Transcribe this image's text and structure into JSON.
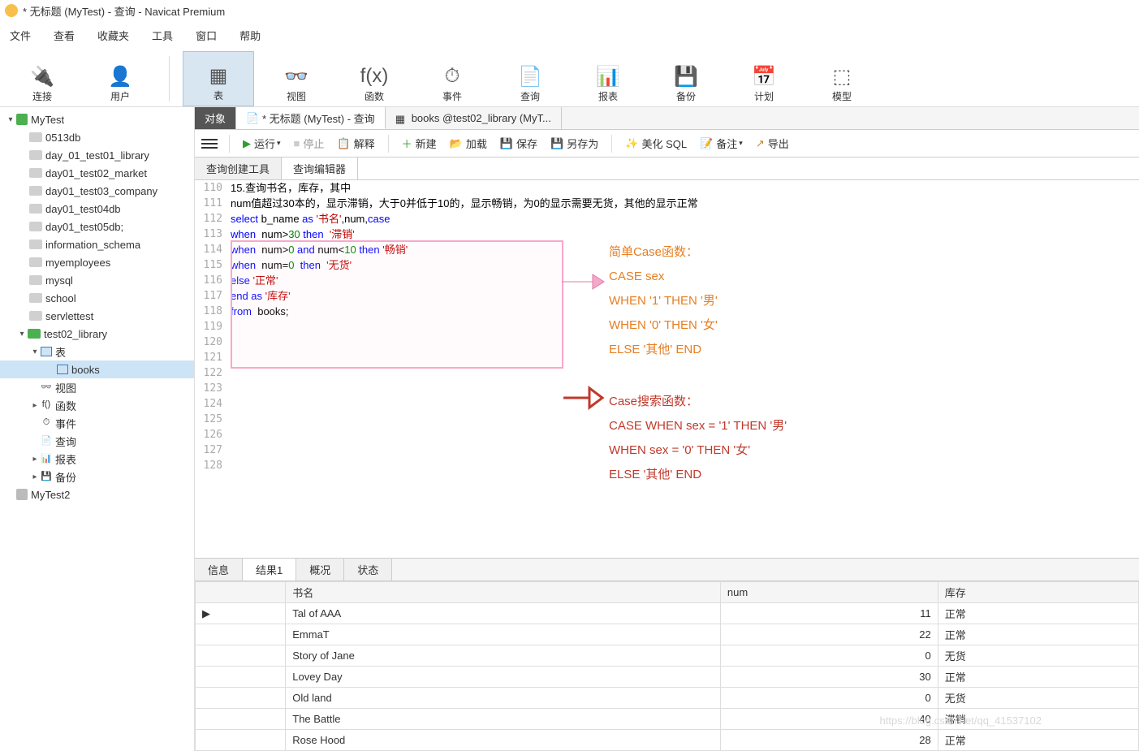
{
  "title": "* 无标题 (MyTest) - 查询 - Navicat Premium",
  "menu": [
    "文件",
    "查看",
    "收藏夹",
    "工具",
    "窗口",
    "帮助"
  ],
  "toolbar": [
    {
      "id": "connect",
      "label": "连接",
      "glyph": "🔌"
    },
    {
      "id": "user",
      "label": "用户",
      "glyph": "👤"
    },
    {
      "id": "table",
      "label": "表",
      "glyph": "▦",
      "sel": true
    },
    {
      "id": "view",
      "label": "视图",
      "glyph": "👓"
    },
    {
      "id": "func",
      "label": "函数",
      "glyph": "f(x)"
    },
    {
      "id": "event",
      "label": "事件",
      "glyph": "⏱"
    },
    {
      "id": "query",
      "label": "查询",
      "glyph": "📄"
    },
    {
      "id": "report",
      "label": "报表",
      "glyph": "📊"
    },
    {
      "id": "backup",
      "label": "备份",
      "glyph": "💾"
    },
    {
      "id": "schedule",
      "label": "计划",
      "glyph": "📅"
    },
    {
      "id": "model",
      "label": "模型",
      "glyph": "⬚"
    }
  ],
  "tree": {
    "server": "MyTest",
    "server2": "MyTest2",
    "dbs": [
      "0513db",
      "day_01_test01_library",
      "day01_test02_market",
      "day01_test03_company",
      "day01_test04db",
      "day01_test05db;",
      "information_schema",
      "myemployees",
      "mysql",
      "school",
      "servlettest"
    ],
    "openDb": "test02_library",
    "tablesLabel": "表",
    "tables": [
      "books"
    ],
    "objs": [
      {
        "label": "视图",
        "glyph": "👓"
      },
      {
        "label": "函数",
        "glyph": "f()"
      },
      {
        "label": "事件",
        "glyph": "⏱"
      },
      {
        "label": "查询",
        "glyph": "📄"
      },
      {
        "label": "报表",
        "glyph": "📊"
      },
      {
        "label": "备份",
        "glyph": "💾"
      }
    ]
  },
  "docTabs": {
    "obj": "对象",
    "qry": "* 无标题 (MyTest) - 查询",
    "tbl": "books @test02_library (MyT..."
  },
  "actions": {
    "run": "运行",
    "stop": "停止",
    "explain": "解释",
    "new": "新建",
    "load": "加载",
    "save": "保存",
    "saveAs": "另存为",
    "beautify": "美化 SQL",
    "memo": "备注",
    "export": "导出"
  },
  "subtabs": {
    "builder": "查询创建工具",
    "editor": "查询编辑器"
  },
  "lineStart": 110,
  "lineCount": 19,
  "sql": {
    "l111": "15.查询书名，库存，其中",
    "l112": "num值超过30本的，显示滞销，大于0并低于10的，显示畅销，为0的显示需要无货，其他的显示正常",
    "l114_a": "select",
    "l114_b": " b_name ",
    "l114_c": "as",
    "l114_d": " '书名'",
    "l114_e": ",num,",
    "l114_f": "case",
    "l115_a": "when",
    "l115_b": "  num>",
    "l115_c": "30",
    "l115_d": " then",
    "l115_e": "  '滞销'",
    "l116_a": "when",
    "l116_b": "  num>",
    "l116_c": "0",
    "l116_d": " and",
    "l116_e": " num<",
    "l116_f": "10",
    "l116_g": " then",
    "l116_h": " '畅销'",
    "l117_a": "when",
    "l117_b": "  num=",
    "l117_c": "0",
    "l117_d": "  then",
    "l117_e": "  '无货'",
    "l118_a": "else",
    "l118_b": " '正常'",
    "l119_a": "end as",
    "l119_b": " '库存'",
    "l120_a": "from",
    "l120_b": "  books;"
  },
  "annot_o": [
    "简单Case函数：",
    "CASE sex",
    "WHEN  '1'  THEN  '男'",
    "WHEN  '0'  THEN  '女'",
    "ELSE  '其他'  END"
  ],
  "annot_r": [
    "Case搜索函数：",
    "CASE WHEN sex =  '1'  THEN  '男'",
    "WHEN sex =  '0'  THEN  '女'",
    "ELSE  '其他'  END"
  ],
  "resultTabs": [
    "信息",
    "结果1",
    "概况",
    "状态"
  ],
  "gridCols": [
    "书名",
    "num",
    "库存"
  ],
  "gridRows": [
    [
      "Tal of AAA",
      "11",
      "正常"
    ],
    [
      "EmmaT",
      "22",
      "正常"
    ],
    [
      "Story of Jane",
      "0",
      "无货"
    ],
    [
      "Lovey Day",
      "30",
      "正常"
    ],
    [
      "Old land",
      "0",
      "无货"
    ],
    [
      "The Battle",
      "40",
      "滞销"
    ],
    [
      "Rose Hood",
      "28",
      "正常"
    ]
  ],
  "watermark": "https://blog.csdn.net/qq_41537102"
}
